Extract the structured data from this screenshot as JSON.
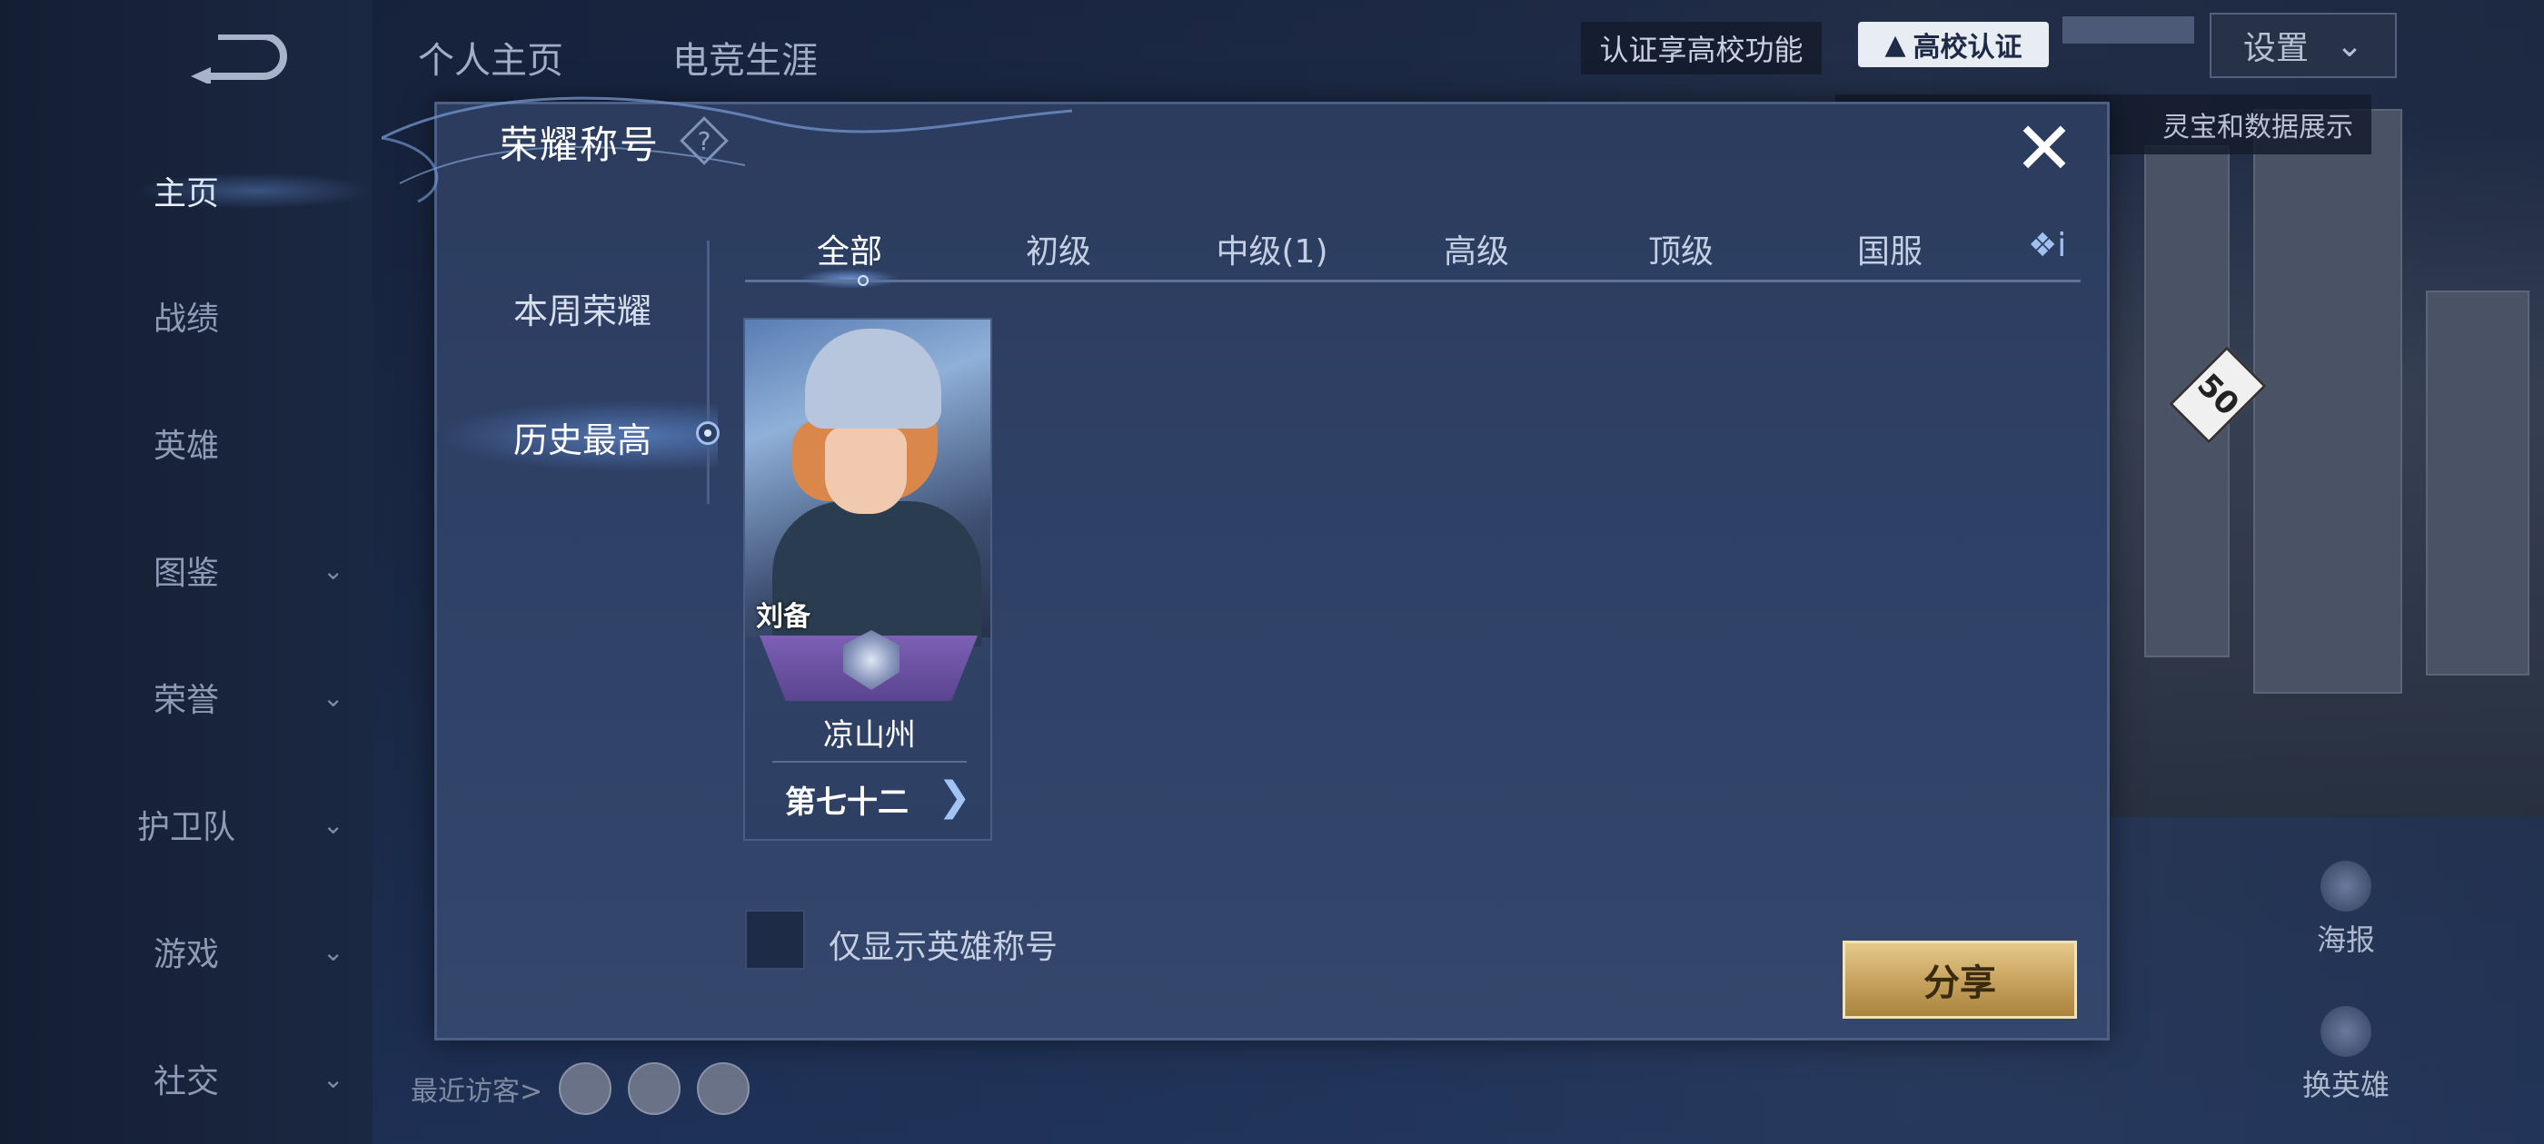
{
  "sidebar": {
    "items": [
      {
        "label": "主页",
        "has_chevron": false
      },
      {
        "label": "战绩",
        "has_chevron": false
      },
      {
        "label": "英雄",
        "has_chevron": false
      },
      {
        "label": "图鉴",
        "has_chevron": true
      },
      {
        "label": "荣誉",
        "has_chevron": true
      },
      {
        "label": "护卫队",
        "has_chevron": true
      },
      {
        "label": "游戏",
        "has_chevron": true
      },
      {
        "label": "社交",
        "has_chevron": true
      }
    ],
    "chevron_glyph": "⌄"
  },
  "topbar": {
    "tab_home": "个人主页",
    "tab_career": "电竞生涯",
    "cert_text": "认证享高校功能",
    "school_cert": "高校认证",
    "settings": "设置",
    "settings_chevron": "⌄",
    "tip_text": "灵宝和数据展示"
  },
  "right_actions": {
    "poster": "海报",
    "change_hero": "换英雄"
  },
  "visitors": {
    "label": "最近访客>"
  },
  "modal": {
    "title": "荣耀称号",
    "help_glyph": "?",
    "close_glyph": "✕",
    "left_nav": [
      {
        "label": "本周荣耀"
      },
      {
        "label": "历史最高"
      }
    ],
    "tabs": [
      {
        "label": "全部"
      },
      {
        "label": "初级"
      },
      {
        "label": "中级(1)"
      },
      {
        "label": "高级"
      },
      {
        "label": "顶级"
      },
      {
        "label": "国服"
      }
    ],
    "more_glyph": "❖ⅰ",
    "card": {
      "hero_name": "刘备",
      "region": "凉山州",
      "rank": "第七十二",
      "chevron_glyph": "❯"
    },
    "checkbox_label": "仅显示英雄称号",
    "share_label": "分享"
  },
  "colors": {
    "accent_blue": "#9fc0f0",
    "share_gold": "#c9a460",
    "rank_purple": "#6b51a3"
  }
}
